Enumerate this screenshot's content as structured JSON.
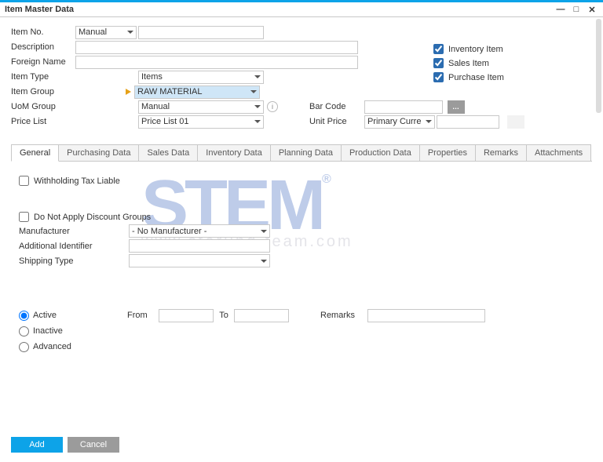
{
  "window": {
    "title": "Item Master Data"
  },
  "right": {
    "inventory": {
      "label": "Inventory Item",
      "checked": true
    },
    "sales": {
      "label": "Sales Item",
      "checked": true
    },
    "purchase": {
      "label": "Purchase Item",
      "checked": true
    }
  },
  "fields": {
    "item_no": {
      "label": "Item No.",
      "mode": "Manual",
      "value": ""
    },
    "description": {
      "label": "Description",
      "value": ""
    },
    "foreign_name": {
      "label": "Foreign Name",
      "value": ""
    },
    "item_type": {
      "label": "Item Type",
      "value": "Items"
    },
    "item_group": {
      "label": "Item Group",
      "value": "RAW MATERIAL"
    },
    "uom_group": {
      "label": "UoM Group",
      "value": "Manual"
    },
    "price_list": {
      "label": "Price List",
      "value": "Price List 01"
    },
    "bar_code": {
      "label": "Bar Code",
      "value": ""
    },
    "unit_price": {
      "label": "Unit Price",
      "currency": "Primary Curre",
      "value": ""
    }
  },
  "tabs": {
    "general": "General",
    "purchasing": "Purchasing Data",
    "sales": "Sales Data",
    "inventory": "Inventory Data",
    "planning": "Planning Data",
    "production": "Production Data",
    "properties": "Properties",
    "remarks": "Remarks",
    "attachments": "Attachments"
  },
  "general": {
    "withholding": {
      "label": "Withholding Tax Liable",
      "checked": false
    },
    "no_discount": {
      "label": "Do Not Apply Discount Groups",
      "checked": false
    },
    "manufacturer": {
      "label": "Manufacturer",
      "value": "- No Manufacturer -"
    },
    "additional_id": {
      "label": "Additional Identifier",
      "value": ""
    },
    "shipping_type": {
      "label": "Shipping Type",
      "value": ""
    },
    "status": {
      "active": "Active",
      "inactive": "Inactive",
      "advanced": "Advanced"
    },
    "from": "From",
    "to": "To",
    "remarks_label": "Remarks"
  },
  "buttons": {
    "add": "Add",
    "cancel": "Cancel"
  },
  "watermark": {
    "logo": "STEM",
    "reg": "®",
    "url": "www.sterling-team.com"
  }
}
